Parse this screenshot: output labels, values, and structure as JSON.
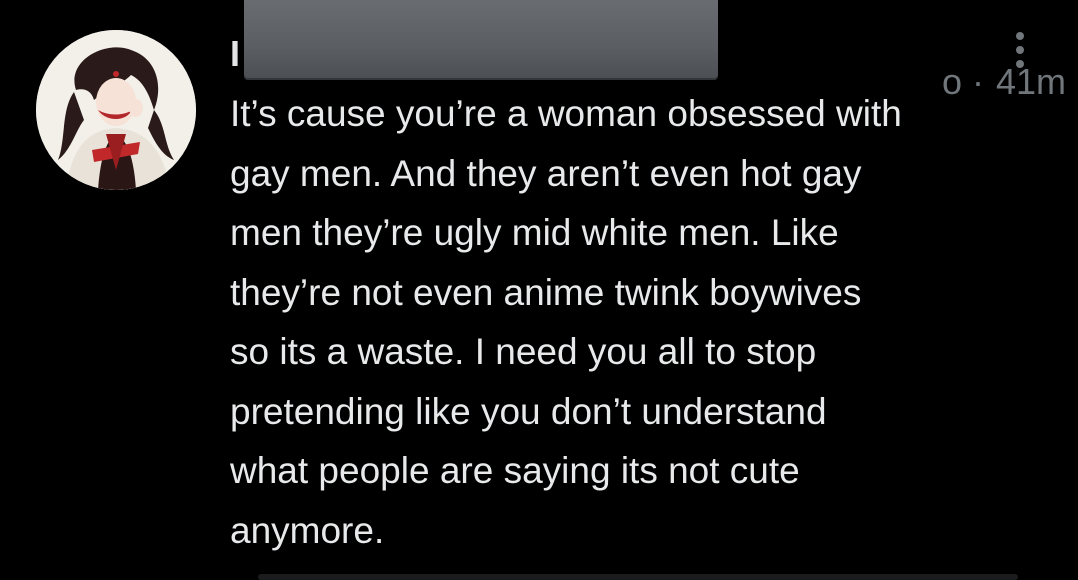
{
  "tweet": {
    "author_initial": "I",
    "handle_tail": "o",
    "separator": "·",
    "timestamp": "41m",
    "text": "It’s cause you’re a woman obsessed with\ngay men. And they aren’t even hot gay\nmen they’re ugly mid white men. Like\nthey’re not even anime twink boywives\nso its a waste. I need you all to stop\npretending like you don’t understand\nwhat people are saying its not cute\nanymore.",
    "more_icon": "more-vertical-icon"
  },
  "colors": {
    "background": "#000000",
    "primary_text": "#e7e9ea",
    "secondary_text": "#71767b",
    "redaction_box": "#5f6367"
  }
}
